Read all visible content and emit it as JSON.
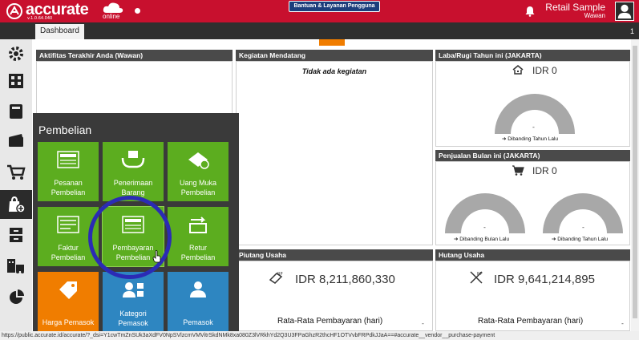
{
  "header": {
    "brand": "accurate",
    "version": "v.1.0.64.040",
    "online": "online",
    "help_button": "Bantuan & Layanan Pengguna",
    "user_name": "Retail Sample",
    "user_sub": "Wawan",
    "icons": [
      "accurate-logo-icon",
      "cloud-icon",
      "bell-icon",
      "user-icon"
    ]
  },
  "tabs": {
    "dashboard": "Dashboard",
    "count": "1"
  },
  "sidebar": {
    "icons": [
      "gear-icon",
      "building-icon",
      "book-icon",
      "wallet-icon",
      "cart-icon",
      "purchase-bag-icon",
      "archive-icon",
      "warehouse-icon",
      "pie-chart-icon"
    ]
  },
  "panels": {
    "activity": "Aktifitas Terakhir Anda (Wawan)",
    "events": "Kegiatan Mendatang",
    "no_events": "Tidak ada kegiatan",
    "profit": "Laba/Rugi Tahun ini (JAKARTA)",
    "profit_value": "IDR 0",
    "profit_dash": "-",
    "profit_compare": "Dibanding Tahun Lalu",
    "sales": "Penjualan Bulan ini (JAKARTA)",
    "sales_value": "IDR 0",
    "sales_dash1": "-",
    "sales_dash2": "-",
    "sales_compare_month": "Dibanding Bulan Lalu",
    "sales_compare_year": "Dibanding Tahun Lalu",
    "receivable": "Piutang Usaha",
    "receivable_value": "IDR 8,211,860,330",
    "receivable_avg": "Rata-Rata Pembayaran (hari)",
    "receivable_dash": "-",
    "payable": "Hutang Usaha",
    "payable_value": "IDR 9,641,214,895",
    "payable_avg": "Rata-Rata Pembayaran (hari)",
    "payable_dash": "-"
  },
  "menu": {
    "title": "Pembelian",
    "tiles": [
      {
        "label1": "Pesanan",
        "label2": "Pembelian",
        "icon": "order-icon",
        "color": "#5cad1f"
      },
      {
        "label1": "Penerimaan",
        "label2": "Barang",
        "icon": "receive-goods-icon",
        "color": "#5cad1f"
      },
      {
        "label1": "Uang Muka",
        "label2": "Pembelian",
        "icon": "down-payment-icon",
        "color": "#5cad1f"
      },
      {
        "label1": "Faktur",
        "label2": "Pembelian",
        "icon": "invoice-icon",
        "color": "#5cad1f"
      },
      {
        "label1": "Pembayaran",
        "label2": "Pembelian",
        "icon": "payment-icon",
        "color": "#5cad1f"
      },
      {
        "label1": "Retur",
        "label2": "Pembelian",
        "icon": "return-icon",
        "color": "#5cad1f"
      },
      {
        "label1": "Harga Pemasok",
        "label2": "",
        "icon": "price-tag-icon",
        "color": "#f07d00"
      },
      {
        "label1": "Kategori",
        "label2": "Pemasok",
        "icon": "category-icon",
        "color": "#2e86c1"
      },
      {
        "label1": "Pemasok",
        "label2": "",
        "icon": "supplier-icon",
        "color": "#2e86c1"
      }
    ]
  },
  "status_bar": "https://public.accurate.id/accurate/?_dsi=Y1cwTmZnSUk3aXdFV0NpSVlzcmVMVitrSkdNMk8xa080Z3lVRkhYd2Q3U3FPaGhzR2thcHF1OTVvbFRPdkJJaA==#accurate__vendor__purchase-payment"
}
